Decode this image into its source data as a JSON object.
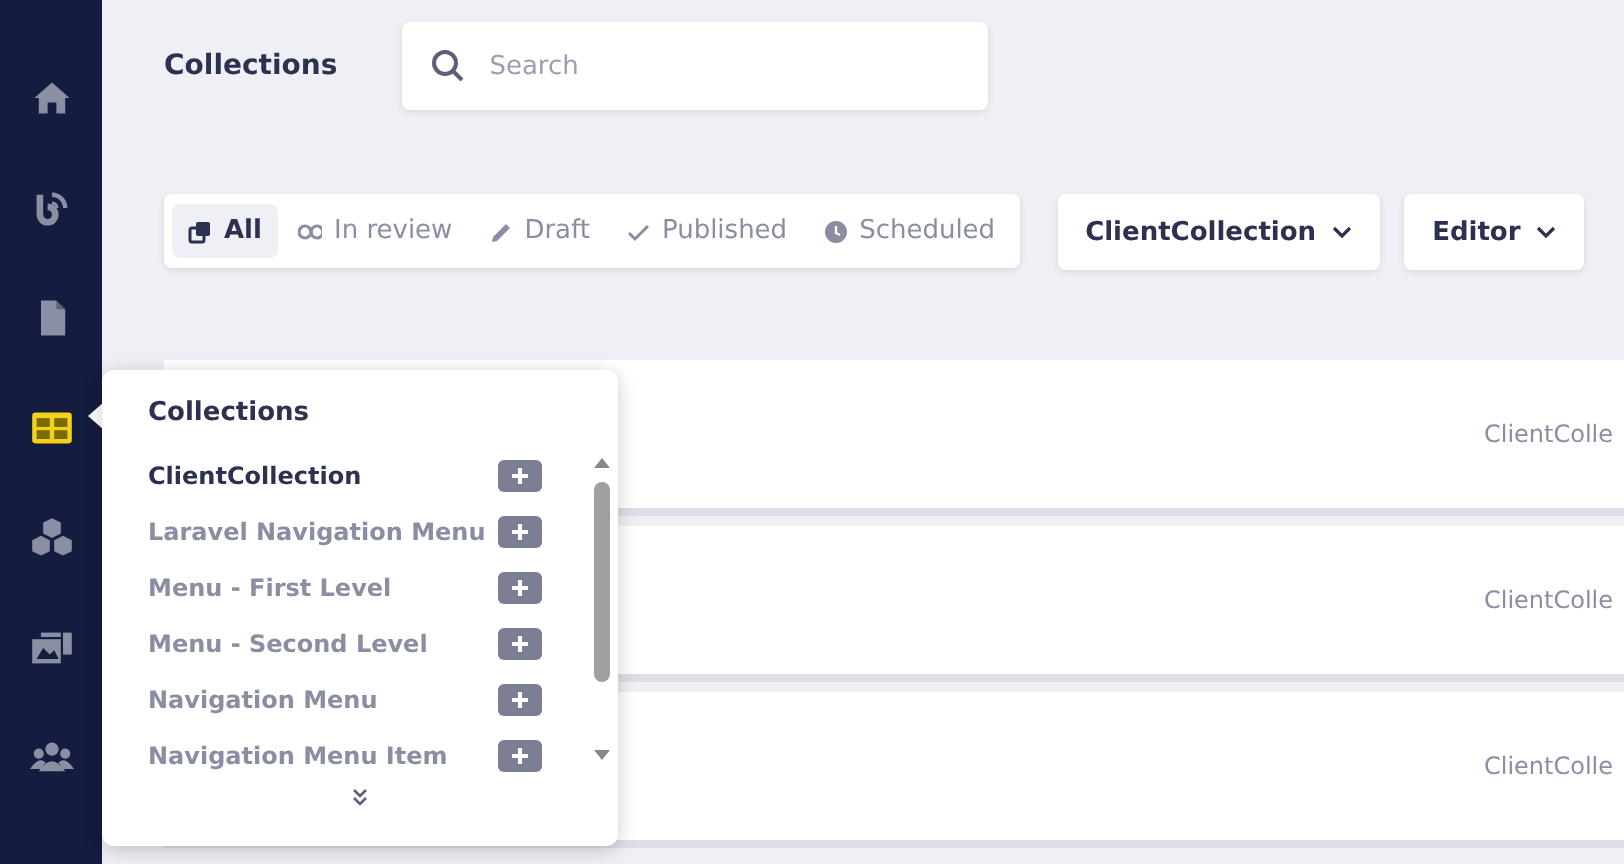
{
  "sidebar": {
    "items": [
      {
        "kind": "home",
        "selected": false
      },
      {
        "kind": "feed",
        "selected": false
      },
      {
        "kind": "page",
        "selected": false
      },
      {
        "kind": "collections",
        "selected": true
      },
      {
        "kind": "blocks",
        "selected": false
      },
      {
        "kind": "media",
        "selected": false
      },
      {
        "kind": "users",
        "selected": false
      }
    ]
  },
  "header": {
    "title": "Collections",
    "search": {
      "placeholder": "Search"
    }
  },
  "filters": [
    {
      "kind": "all",
      "label": "All",
      "selected": true
    },
    {
      "kind": "review",
      "label": "In review",
      "selected": false
    },
    {
      "kind": "draft",
      "label": "Draft",
      "selected": false
    },
    {
      "kind": "published",
      "label": "Published",
      "selected": false
    },
    {
      "kind": "scheduled",
      "label": "Scheduled",
      "selected": false
    }
  ],
  "dropdowns": [
    {
      "label": "ClientCollection"
    },
    {
      "label": "Editor"
    }
  ],
  "rows": [
    {
      "column_2": "ClientColle"
    },
    {
      "column_2": "ClientColle"
    },
    {
      "column_2": "ClientColle"
    }
  ],
  "popover": {
    "title": "Collections",
    "items": [
      {
        "label": "ClientCollection",
        "selected": true
      },
      {
        "label": "Laravel Navigation Menu",
        "selected": false
      },
      {
        "label": "Menu - First Level",
        "selected": false
      },
      {
        "label": "Menu - Second Level",
        "selected": false
      },
      {
        "label": "Navigation Menu",
        "selected": false
      },
      {
        "label": "Navigation Menu Item",
        "selected": false
      }
    ]
  }
}
